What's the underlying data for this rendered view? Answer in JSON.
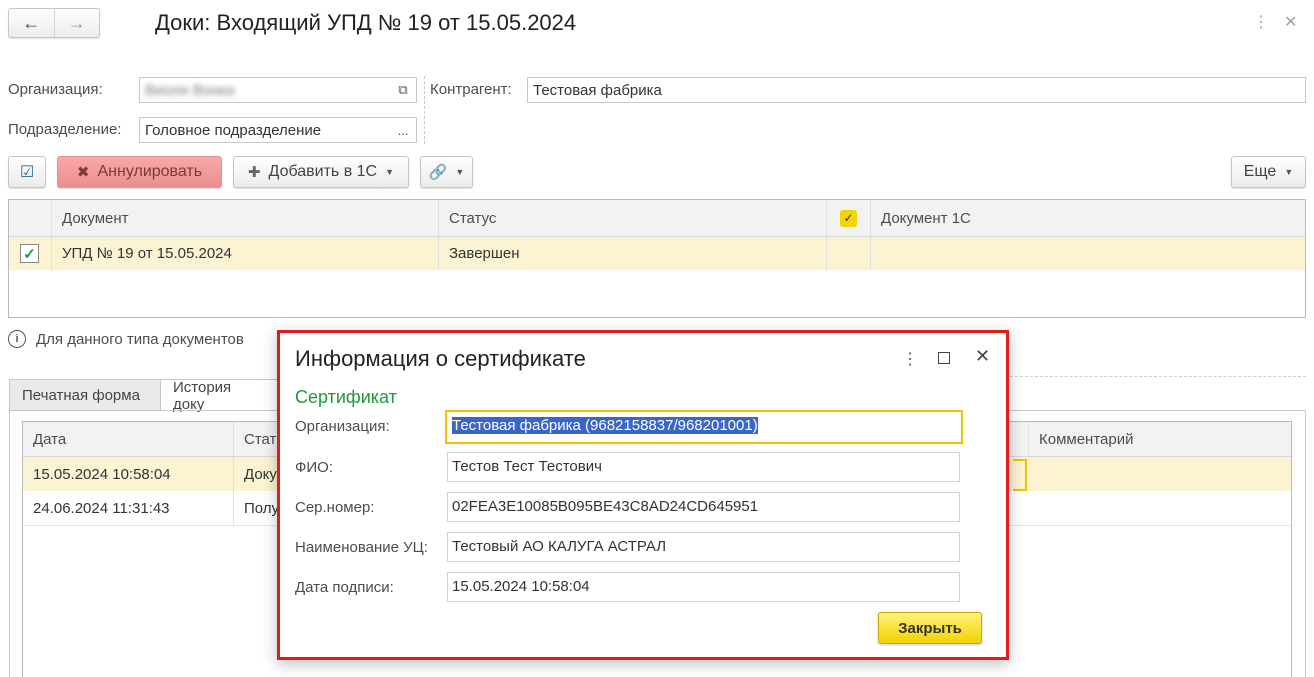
{
  "window": {
    "title": "Доки: Входящий УПД № 19 от 15.05.2024",
    "menu_icon": "more-vertical-icon",
    "close_icon": "close-icon"
  },
  "header": {
    "org_label": "Организация:",
    "org_value": "Виоли Вонка",
    "dept_label": "Подразделение:",
    "dept_value": "Головное подразделение",
    "dept_select": "...",
    "contractor_label": "Контрагент:",
    "contractor_value": "Тестовая фабрика"
  },
  "toolbar": {
    "cancel_label": "Аннулировать",
    "add_label": "Добавить в 1С",
    "more_label": "Еще"
  },
  "doc_table": {
    "columns": [
      "Документ",
      "Статус",
      "Документ 1С"
    ],
    "rows": [
      {
        "document": "УПД № 19 от 15.05.2024",
        "status": "Завершен",
        "doc1c": "",
        "checked": true
      }
    ]
  },
  "info_text": "Для данного типа документов",
  "tabs": [
    "Печатная форма",
    "История доку"
  ],
  "history_table": {
    "columns": [
      "Дата",
      "Стат",
      "Комментарий"
    ],
    "rows": [
      {
        "date": "15.05.2024 10:58:04",
        "status": "Доку"
      },
      {
        "date": "24.06.2024 11:31:43",
        "status": "Полу"
      }
    ]
  },
  "dialog": {
    "title": "Информация о сертификате",
    "section": "Сертификат",
    "fields": [
      {
        "label": "Организация:",
        "value": "Тестовая фабрика (9682158837/968201001)"
      },
      {
        "label": "ФИО:",
        "value": "Тестов Тест Тестович"
      },
      {
        "label": "Сер.номер:",
        "value": "02FEA3E10085B095BE43C8AD24CD645951"
      },
      {
        "label": "Наименование УЦ:",
        "value": "Тестовый АО КАЛУГА АСТРАЛ"
      },
      {
        "label": "Дата подписи:",
        "value": "15.05.2024 10:58:04"
      }
    ],
    "close_label": "Закрыть"
  },
  "colors": {
    "accent_red": "#e01b1b",
    "section_green": "#1e9a3c",
    "selected_row": "#fbf3d2",
    "primary_yellow": "#f2d400"
  }
}
